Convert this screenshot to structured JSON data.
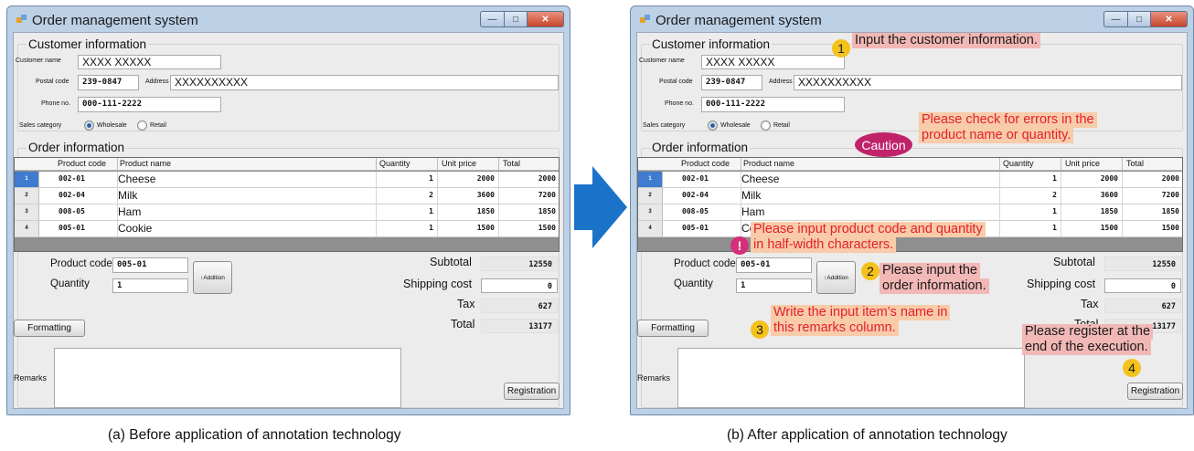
{
  "window": {
    "title": "Order management system"
  },
  "customer": {
    "group_label": "Customer information",
    "name_label": "Customer name",
    "name_value": "XXXX XXXXX",
    "postal_label": "Postal code",
    "postal_value": "239-0847",
    "address_label": "Address",
    "address_value": "XXXXXXXXXX",
    "phone_label": "Phone no.",
    "phone_value": "000-111-2222",
    "sales_label": "Sales category",
    "sales_options": [
      "Wholesale",
      "Retail"
    ],
    "sales_selected": "Wholesale"
  },
  "order": {
    "group_label": "Order information",
    "columns": [
      "Product code",
      "Product name",
      "Quantity",
      "Unit price",
      "Total"
    ],
    "rows": [
      {
        "num": "1",
        "code": "002-01",
        "name": "Cheese",
        "qty": "1",
        "price": "2000",
        "total": "2000"
      },
      {
        "num": "2",
        "code": "002-04",
        "name": "Milk",
        "qty": "2",
        "price": "3600",
        "total": "7200"
      },
      {
        "num": "3",
        "code": "008-05",
        "name": "Ham",
        "qty": "1",
        "price": "1850",
        "total": "1850"
      },
      {
        "num": "4",
        "code": "005-01",
        "name": "Cookie",
        "qty": "1",
        "price": "1500",
        "total": "1500"
      }
    ],
    "row4_name_b": "Co",
    "product_code_label": "Product code",
    "product_code_value": "005-01",
    "quantity_label": "Quantity",
    "quantity_value": "1",
    "addition_label": "Addition",
    "addition_icon": "arrow-up-icon",
    "subtotal_label": "Subtotal",
    "subtotal_value": "12550",
    "shipping_label": "Shipping cost",
    "shipping_value": "0",
    "tax_label": "Tax",
    "tax_value": "627",
    "total_label": "Total",
    "total_value": "13177"
  },
  "formatting_label": "Formatting",
  "remarks_label": "Remarks",
  "registration_label": "Registration",
  "annotations": {
    "n1": "1",
    "a1": "Input the customer information.",
    "caution": "Caution",
    "caution_text_1": "Please check for errors in the",
    "caution_text_2": "product name or quantity.",
    "bang": "!",
    "half_1": "Please input product code and quantity",
    "half_2": "in half-width characters.",
    "n2": "2",
    "a2_1": "Please input the",
    "a2_2": "order information.",
    "n3": "3",
    "a3_1": "Write the input item’s name in",
    "a3_2": "this remarks column.",
    "a4_1": "Please register at the",
    "a4_2": "end of the execution.",
    "n4": "4"
  },
  "captions": {
    "before": "(a) Before application of annotation technology",
    "after": "(b) After application of annotation technology"
  },
  "colors": {
    "arrow": "#1a73c9",
    "annotation_red": "#e3202a",
    "pink_bg": "#f2b8b5",
    "peach_bg": "#f8cba9",
    "number_badge": "#f4c21b",
    "caution_badge": "#c0236a"
  }
}
